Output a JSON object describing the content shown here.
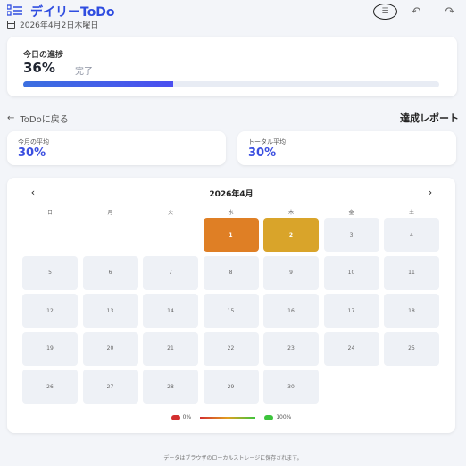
{
  "app": {
    "title": "デイリーToDo",
    "date": "2026年4月2日木曜日"
  },
  "header": {
    "list_icon": "list-icon",
    "undo_icon": "undo-icon",
    "redo_icon": "redo-icon"
  },
  "progress": {
    "label": "今日の進捗",
    "percent_text": "36%",
    "done_label": "完了",
    "value": 0.36,
    "bar_color": "#3b5ce8"
  },
  "nav": {
    "back_label": "ToDoに戻る",
    "report_title": "達成レポート"
  },
  "stats": {
    "monthly": {
      "label": "今月の平均",
      "value": "30%"
    },
    "total": {
      "label": "トータル平均",
      "value": "30%"
    }
  },
  "calendar": {
    "month_label": "2026年4月",
    "prev": "‹",
    "next": "›",
    "weekdays": [
      "日",
      "月",
      "火",
      "水",
      "木",
      "金",
      "土"
    ],
    "days": [
      {
        "d": "1",
        "color": "#df7f25"
      },
      {
        "d": "2",
        "color": "#d9a42a"
      },
      {
        "d": "3"
      },
      {
        "d": "4"
      },
      {
        "d": "5"
      },
      {
        "d": "6"
      },
      {
        "d": "7"
      },
      {
        "d": "8"
      },
      {
        "d": "9"
      },
      {
        "d": "10"
      },
      {
        "d": "11"
      },
      {
        "d": "12"
      },
      {
        "d": "13"
      },
      {
        "d": "14"
      },
      {
        "d": "15"
      },
      {
        "d": "16"
      },
      {
        "d": "17"
      },
      {
        "d": "18"
      },
      {
        "d": "19"
      },
      {
        "d": "20"
      },
      {
        "d": "21"
      },
      {
        "d": "22"
      },
      {
        "d": "23"
      },
      {
        "d": "24"
      },
      {
        "d": "25"
      },
      {
        "d": "26"
      },
      {
        "d": "27"
      },
      {
        "d": "28"
      },
      {
        "d": "29"
      },
      {
        "d": "30"
      }
    ],
    "first_weekday": 3,
    "legend": {
      "low_label": "0%",
      "high_label": "100%",
      "low_color": "#d32f2f",
      "high_color": "#3cc43c"
    }
  },
  "footer": "データはブラウザのローカルストレージに保存されます。"
}
